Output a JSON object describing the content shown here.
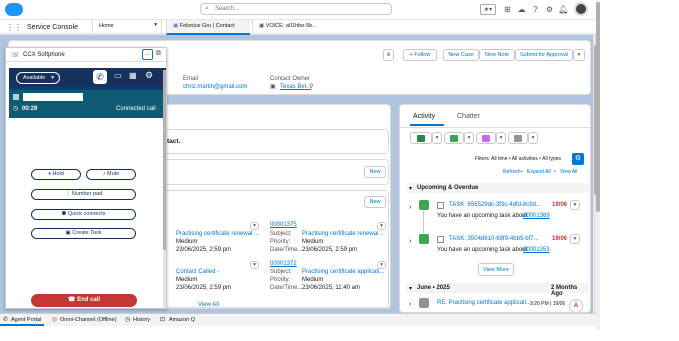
{
  "topbar": {
    "search_placeholder": "Search..."
  },
  "nav": {
    "app_name": "Service Console",
    "tabs": [
      {
        "label": "Home"
      },
      {
        "label": "Felonius Gru | Contact"
      },
      {
        "label": "VOICE: a01hbe-5b..."
      }
    ]
  },
  "record": {
    "actions": [
      "+ Follow",
      "New Case",
      "New Note",
      "Submit for Approval"
    ],
    "email_label": "Email",
    "email_value": "chriz.martin@gmail.com",
    "owner_label": "Contact Owner",
    "owner_value": "Texas Bel...",
    "partial_text": "ntact."
  },
  "related": {
    "new_label": "New",
    "view_all": "View All",
    "left_items": [
      {
        "title": "Practising certificate renewal ...",
        "sub": "Medium",
        "date": "23/06/2025, 2:59 pm"
      },
      {
        "title": "Contact Called -",
        "sub": "Medium",
        "date": "23/06/2025, 2:59 pm"
      }
    ],
    "right_items": [
      {
        "number": "00001375",
        "subject_label": "Subject:",
        "subject": "Practising certificate renewal ...",
        "priority_label": "Priority:",
        "priority": "Medium",
        "dt_label": "Date/Time...",
        "dt": "23/06/2025, 2:59 pm"
      },
      {
        "number": "00001372",
        "subject_label": "Subject:",
        "subject": "Practising certificate applicati...",
        "priority_label": "Priority:",
        "priority": "Medium",
        "dt_label": "Date/Time...",
        "dt": "23/06/2025, 11:40 am"
      }
    ]
  },
  "activity": {
    "tab_activity": "Activity",
    "tab_chatter": "Chatter",
    "filters": "Filters: All time • All activities • All types",
    "refresh": "Refresh",
    "expand": "Expand All",
    "view_all": "View All",
    "upcoming_header": "Upcoming & Overdue",
    "tasks": [
      {
        "title": "TASK: 656529dc-3f3c-4dfd-8c9d...",
        "date": "19/06",
        "desc": "You have an upcoming task about",
        "link": "00001369"
      },
      {
        "title": "TASK: 3504d610-69f9-4bb5-bf7...",
        "date": "19/06",
        "desc": "You have an upcoming task about",
        "link": "00001353"
      }
    ],
    "view_more": "View More",
    "month_header": "June • 2025",
    "month_ago": "2 Months Ago",
    "email_item": {
      "title": "RE: Practising certificate applicati...",
      "time": "3:26 PM | 19/06"
    }
  },
  "softphone": {
    "title": "CCX Softphone",
    "status": "Available",
    "timer": "00:29",
    "call_state": "Connected call",
    "buttons": {
      "hold": "Hold",
      "mute": "Mute",
      "numpad": "Number pad",
      "quick": "Quick connects",
      "task": "Create Task"
    },
    "end_call": "End call"
  },
  "utility": {
    "items": [
      "Agent Portal",
      "Omni-Channel (Offline)",
      "History",
      "Amazon Q"
    ]
  },
  "colors": {
    "brand": "#0176d3",
    "end_call": "#c23934",
    "softphone_dark": "#16325c",
    "teal": "#0f5b73",
    "green_task": "#2e844a"
  }
}
